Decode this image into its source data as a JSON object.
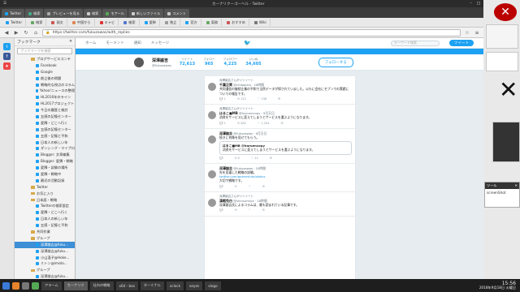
{
  "window_title": "カーナリクーゴーヘル - Twitter",
  "tabs": [
    {
      "label": "Twitter"
    },
    {
      "label": "検索"
    },
    {
      "label": "プレビューを見る"
    },
    {
      "label": "検索"
    },
    {
      "label": "モアール"
    },
    {
      "label": "新しいファイル"
    },
    {
      "label": "コメント"
    }
  ],
  "bookmarks": [
    {
      "label": "Twitter",
      "color": "#1da1f2"
    },
    {
      "label": "検索",
      "color": "#6a6"
    },
    {
      "label": "発文",
      "color": "#c55"
    },
    {
      "label": "中国から",
      "color": "#d85"
    },
    {
      "label": "キャビ",
      "color": "#d33"
    },
    {
      "label": "検索",
      "color": "#57c"
    },
    {
      "label": "愛幹",
      "color": "#1da1f2"
    },
    {
      "label": "独立",
      "color": "#999"
    },
    {
      "label": "官方",
      "color": "#1da1f2"
    },
    {
      "label": "実務",
      "color": "#6a6"
    },
    {
      "label": "おすすめ",
      "color": "#c55"
    },
    {
      "label": "Wiki",
      "color": "#777"
    }
  ],
  "url": "https://twitter.com/fukuzawas/with_replies",
  "sidebar": {
    "header": "ブックマーク",
    "search_placeholder": "ブックマークを検索",
    "items": [
      {
        "label": "ブログサービスコンテ",
        "kind": "folder"
      },
      {
        "label": "Facebook",
        "kind": "link"
      },
      {
        "label": "Google",
        "kind": "link"
      },
      {
        "label": "創立後の問題",
        "kind": "link"
      },
      {
        "label": "戦略的な視点のコラム",
        "kind": "link"
      },
      {
        "label": "Yahoo!ニュースの整理",
        "kind": "link"
      },
      {
        "label": "HL2016年のライン",
        "kind": "link"
      },
      {
        "label": "HL2017プロジェクト",
        "kind": "link"
      },
      {
        "label": "今日の履歴と検討",
        "kind": "link"
      },
      {
        "label": "五感の記憶センター",
        "kind": "link"
      },
      {
        "label": "愛隣・どこへ行く",
        "kind": "link"
      },
      {
        "label": "五感の記憶センター",
        "kind": "link"
      },
      {
        "label": "五感・記憶と平和",
        "kind": "link"
      },
      {
        "label": "日本人の新しい年",
        "kind": "link"
      },
      {
        "label": "ダンシング・マイプロ",
        "kind": "link"
      },
      {
        "label": "Blogger: 文章編集",
        "kind": "link"
      },
      {
        "label": "Blogger: 愛隣・戦略",
        "kind": "link"
      },
      {
        "label": "愛隣・試験の場所",
        "kind": "link"
      },
      {
        "label": "愛隣・戦略中",
        "kind": "link"
      },
      {
        "label": "最近の活動記録",
        "kind": "link"
      },
      {
        "label": "Twitter",
        "kind": "folder"
      },
      {
        "label": "お気に入り",
        "kind": "folder"
      },
      {
        "label": "日本語・戦略",
        "kind": "folder"
      },
      {
        "label": "Twitterの検索設定",
        "kind": "link"
      },
      {
        "label": "愛隣・どこへ行く",
        "kind": "link"
      },
      {
        "label": "日本人の新しい年",
        "kind": "link"
      },
      {
        "label": "五感・記憶と平和",
        "kind": "link"
      },
      {
        "label": "共同作業",
        "kind": "folder"
      },
      {
        "label": "グループ",
        "kind": "folder"
      },
      {
        "label": "深澤諭吉@fuku...",
        "kind": "link",
        "selected": true
      },
      {
        "label": "深澤諭吉@fuku...",
        "kind": "link"
      },
      {
        "label": "小山温子@Hoke...",
        "kind": "link"
      },
      {
        "label": "ミトン@imoto...",
        "kind": "link"
      },
      {
        "label": "グループ",
        "kind": "folder"
      },
      {
        "label": "深澤諭吉@fuku...",
        "kind": "link"
      }
    ]
  },
  "twitter": {
    "nav": [
      "ホーム",
      "モーメント",
      "通知",
      "メッセージ"
    ],
    "search_placeholder": "キーワード検索",
    "tweet_button": "ツイート",
    "profile": {
      "name": "深澤諭吉",
      "handle": "@fukuzawas",
      "stats": [
        {
          "label": "ツイート",
          "value": "72,613"
        },
        {
          "label": "フォロー",
          "value": "965"
        },
        {
          "label": "フォロワー",
          "value": "4,225"
        },
        {
          "label": "いいね",
          "value": "34,605"
        }
      ],
      "follow_button": "フォローする"
    },
    "tweets": [
      {
        "context": "深澤諭吉さんがリツイート",
        "name": "千葉正実",
        "meta": "@chibaprro · 18時間",
        "body": "共同通信の継続企業の平和で当然データが探されていました。以もに会社にセブンでの実績についての報告です。",
        "replies": "1",
        "retweets": "122",
        "likes": "238"
      },
      {
        "context": "深澤諭吉さんがリツイート",
        "name": "はるこ■MB",
        "meta": "@haruencopy · 9月又日",
        "body": "消費をサービスに変えてしまうとサービスを選ぶようになります。",
        "replies": "1",
        "retweets": "582",
        "likes": "1,204"
      },
      {
        "context": "",
        "name": "深澤諭吉",
        "meta": "@fukuzawas · 9月又日",
        "body": "続きに何像を見せてもらう。",
        "quote_name": "はるこ■MB @haruencopy",
        "quote_body": "消費をサービスに変えてしまうとサービスを選ぶようになります。",
        "replies": "",
        "retweets": "5",
        "likes": "11"
      },
      {
        "context": "",
        "name": "深澤諭吉",
        "meta": "@fukuzawas · 10時間",
        "body": "先を見通した戦略の試験。",
        "link": "twitter.com/gozenshiro/status",
        "body2": "大切で戦略です。",
        "replies": "",
        "retweets": "",
        "likes": ""
      },
      {
        "context": "深澤諭吉さんがリツイート",
        "name": "漢戦免白",
        "meta": "@shinsumiya · 18時間",
        "body": "深澤諭吉氏によるコラムは、最も読まれている記事です。",
        "replies": "",
        "retweets": "",
        "likes": ""
      }
    ]
  },
  "right_panel": {
    "popup_title": "ツール",
    "popup_label": "screenShot"
  },
  "taskbar": {
    "tasks": [
      {
        "label": "アラーム"
      },
      {
        "label": "カーナリク"
      },
      {
        "label": "社内の戦略"
      },
      {
        "label": "x64 - bas"
      },
      {
        "label": "ターミナル"
      },
      {
        "label": "xclock"
      },
      {
        "label": "xeyes"
      },
      {
        "label": "xlogo"
      }
    ],
    "clock_time": "15:56",
    "clock_date": "2018年9月18日 火曜日"
  }
}
